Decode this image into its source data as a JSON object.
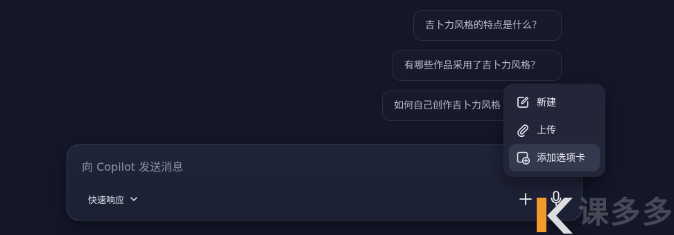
{
  "suggestions": [
    "吉卜力风格的特点是什么？",
    "有哪些作品采用了吉卜力风格？",
    "如何自己创作吉卜力风格"
  ],
  "composer": {
    "placeholder": "向 Copilot 发送消息",
    "mode_label": "快速响应",
    "mode_icon": "chevron-down-icon",
    "plus_icon": "plus-icon",
    "mic_icon": "microphone-icon"
  },
  "menu": {
    "items": [
      {
        "label": "新建",
        "icon": "edit-icon"
      },
      {
        "label": "上传",
        "icon": "paperclip-icon"
      },
      {
        "label": "添加选项卡",
        "icon": "add-tab-icon",
        "selected": true
      }
    ]
  },
  "watermark": {
    "text": "课多多",
    "logo": "K"
  },
  "colors": {
    "background": "#141728",
    "card": "#202439",
    "menu": "#232638",
    "selected_menu_item": "#35394d",
    "text": "#edeff6",
    "muted_text": "#8f94a8",
    "watermark_orange": "#f39a2a"
  }
}
